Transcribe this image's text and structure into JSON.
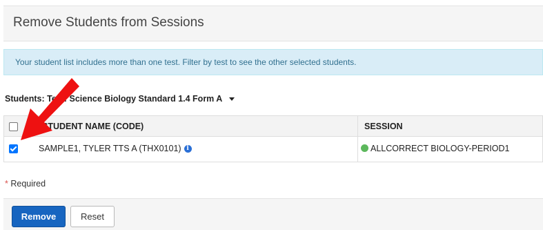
{
  "page": {
    "title": "Remove Students from Sessions"
  },
  "alert": {
    "text": "Your student list includes more than one test. Filter by test to see the other selected students."
  },
  "filter": {
    "label": "Students: Test: Science Biology Standard 1.4 Form A"
  },
  "table": {
    "headers": {
      "name": "STUDENT NAME (CODE)",
      "session": "SESSION"
    },
    "rows": [
      {
        "checked": true,
        "name": "SAMPLE1, TYLER TTS A (THX0101)",
        "session": "ALLCORRECT BIOLOGY-PERIOD1",
        "session_status_color": "#5cb85c"
      }
    ]
  },
  "required": {
    "star": "*",
    "text": "Required"
  },
  "buttons": {
    "remove": "Remove",
    "reset": "Reset"
  },
  "colors": {
    "primary": "#1765c0",
    "alert_bg": "#d9edf7",
    "arrow": "#ee1111"
  },
  "icons": {
    "info": "info-circle-icon",
    "status": "status-dot-icon",
    "annotation": "red-arrow-annotation"
  }
}
